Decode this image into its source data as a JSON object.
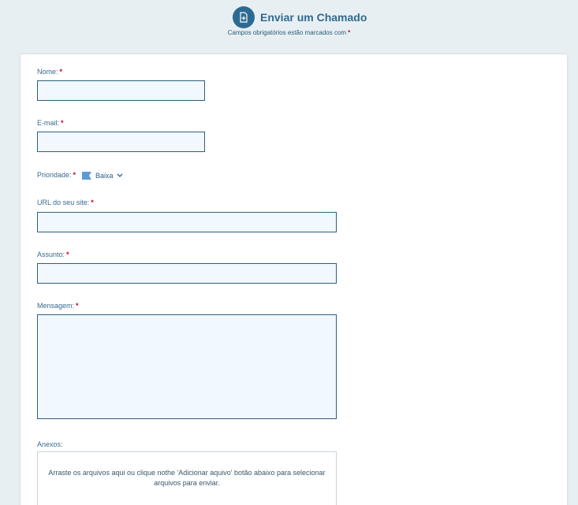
{
  "header": {
    "title": "Enviar um Chamado",
    "subtitle": "Campos obrigatórios estão marcados com",
    "required_mark": "*",
    "icon": "document-plus-icon"
  },
  "form": {
    "name_label": "Nome:",
    "email_label": "E-mail:",
    "priority_label": "Prioridade:",
    "priority_value": "Baixa",
    "url_label": "URL do seu site:",
    "subject_label": "Assunto:",
    "message_label": "Mensagem:",
    "attachments_label": "Anexos:",
    "required_mark": "*",
    "dropzone_text": "Arraste os arquivos aqui ou clique nothe 'Adicionar aquivo' botão abaixo para selecionar arquivos para enviar."
  },
  "colors": {
    "accent": "#2c6a93",
    "required": "#d0021b",
    "input_bg": "#f1f8fe",
    "page_bg": "#e8eff3",
    "priority_flag": "#5b9bd5"
  }
}
